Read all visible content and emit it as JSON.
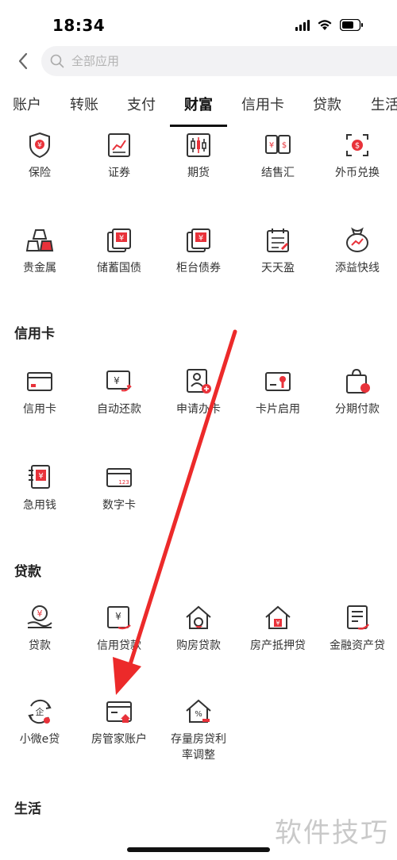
{
  "status": {
    "time": "18:34"
  },
  "search": {
    "placeholder": "全部应用"
  },
  "tabs": [
    {
      "label": "账户"
    },
    {
      "label": "转账"
    },
    {
      "label": "支付"
    },
    {
      "label": "财富"
    },
    {
      "label": "信用卡"
    },
    {
      "label": "贷款"
    },
    {
      "label": "生活"
    }
  ],
  "wealth": {
    "items": [
      {
        "label": "保险",
        "icon": "insurance-shield-icon"
      },
      {
        "label": "证券",
        "icon": "securities-chart-icon"
      },
      {
        "label": "期货",
        "icon": "futures-candlestick-icon"
      },
      {
        "label": "结售汇",
        "icon": "exchange-settlement-icon"
      },
      {
        "label": "外币兑换",
        "icon": "currency-exchange-icon"
      },
      {
        "label": "贵金属",
        "icon": "gold-bars-icon"
      },
      {
        "label": "储蓄国债",
        "icon": "savings-bond-icon"
      },
      {
        "label": "柜台债券",
        "icon": "counter-bond-icon"
      },
      {
        "label": "天天盈",
        "icon": "calendar-icon"
      },
      {
        "label": "添益快线",
        "icon": "money-bag-icon"
      }
    ]
  },
  "credit": {
    "title": "信用卡",
    "items": [
      {
        "label": "信用卡",
        "icon": "credit-card-icon"
      },
      {
        "label": "自动还款",
        "icon": "auto-repay-icon"
      },
      {
        "label": "申请办卡",
        "icon": "apply-card-icon"
      },
      {
        "label": "卡片启用",
        "icon": "card-activate-icon"
      },
      {
        "label": "分期付款",
        "icon": "installment-bag-icon"
      },
      {
        "label": "急用钱",
        "icon": "urgent-money-icon"
      },
      {
        "label": "数字卡",
        "icon": "digital-card-icon"
      }
    ]
  },
  "loan": {
    "title": "贷款",
    "items": [
      {
        "label": "贷款",
        "icon": "loan-hand-icon"
      },
      {
        "label": "信用贷款",
        "icon": "credit-loan-icon"
      },
      {
        "label": "购房贷款",
        "icon": "house-loan-icon"
      },
      {
        "label": "房产抵押贷",
        "icon": "mortgage-house-icon"
      },
      {
        "label": "金融资产贷",
        "icon": "financial-asset-icon"
      },
      {
        "label": "小微e贷",
        "icon": "micro-loan-icon"
      },
      {
        "label": "房管家账户",
        "icon": "house-account-icon"
      },
      {
        "label": "存量房贷利率调整",
        "icon": "rate-adjust-house-icon"
      }
    ]
  },
  "life": {
    "title": "生活"
  },
  "watermark": "软件技巧",
  "colors": {
    "accent": "#e8323a",
    "icon_line": "#333333",
    "arrow": "#ec2a2a"
  }
}
